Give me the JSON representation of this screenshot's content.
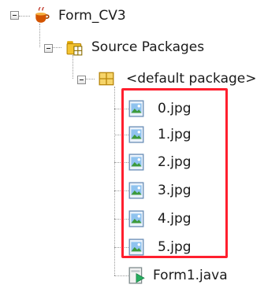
{
  "tree": {
    "project": {
      "label": "Form_CV3",
      "icon": "java-project-icon"
    },
    "source_packages": {
      "label": "Source Packages",
      "icon": "source-packages-icon"
    },
    "default_package": {
      "label": "<default package>",
      "icon": "package-icon"
    },
    "files": [
      {
        "label": "0.jpg",
        "icon": "image-file-icon"
      },
      {
        "label": "1.jpg",
        "icon": "image-file-icon"
      },
      {
        "label": "2.jpg",
        "icon": "image-file-icon"
      },
      {
        "label": "3.jpg",
        "icon": "image-file-icon"
      },
      {
        "label": "4.jpg",
        "icon": "image-file-icon"
      },
      {
        "label": "5.jpg",
        "icon": "image-file-icon"
      },
      {
        "label": "Form1.java",
        "icon": "java-form-file-icon"
      }
    ]
  },
  "highlight_color": "#ff1f2e"
}
